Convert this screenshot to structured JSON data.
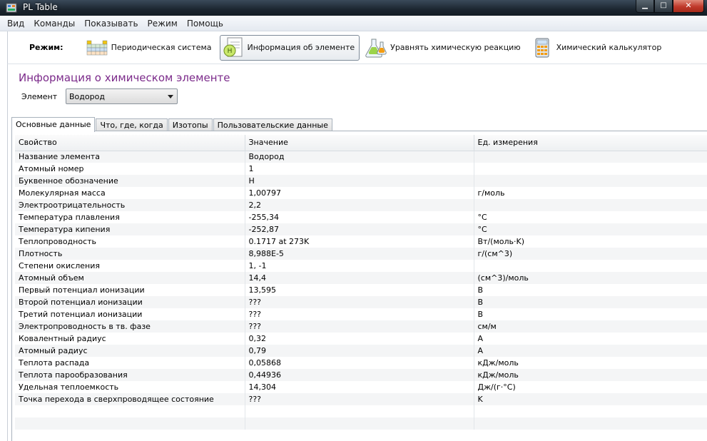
{
  "window": {
    "title": "PL Table"
  },
  "menu": [
    "Вид",
    "Команды",
    "Показывать",
    "Режим",
    "Помощь"
  ],
  "toolbar": {
    "mode_label": "Режим:",
    "buttons": [
      {
        "label": "Периодическая система",
        "icon": "periodic-table-icon",
        "active": false
      },
      {
        "label": "Информация об элементе",
        "icon": "element-info-icon",
        "active": true
      },
      {
        "label": "Уравнять химическую реакцию",
        "icon": "flask-icon",
        "active": false
      },
      {
        "label": "Химический калькулятор",
        "icon": "calculator-icon",
        "active": false
      }
    ]
  },
  "page": {
    "title": "Информация о химическом элементе",
    "element_label": "Элемент",
    "element_value": "Водород"
  },
  "tabs": [
    "Основные данные",
    "Что, где, когда",
    "Изотопы",
    "Пользовательские данные"
  ],
  "table": {
    "headers": [
      "Свойство",
      "Значение",
      "Ед. измерения"
    ],
    "rows": [
      [
        "Название элемента",
        "Водород",
        ""
      ],
      [
        "Атомный номер",
        "1",
        ""
      ],
      [
        "Буквенное обозначение",
        "H",
        ""
      ],
      [
        "Молекулярная масса",
        "1,00797",
        "г/моль"
      ],
      [
        "Электроотрицательность",
        "2,2",
        ""
      ],
      [
        "Температура плавления",
        "-255,34",
        "°C"
      ],
      [
        "Температура кипения",
        "-252,87",
        "°C"
      ],
      [
        "Теплопроводность",
        "0.1717 at 273K",
        "Вт/(моль·K)"
      ],
      [
        "Плотность",
        "8,988E-5",
        "г/(см^3)"
      ],
      [
        "Степени окисления",
        "1, -1",
        ""
      ],
      [
        "Атомный объем",
        "14,4",
        "(см^3)/моль"
      ],
      [
        "Первый потенциал ионизации",
        "13,595",
        "В"
      ],
      [
        "Второй потенциал ионизации",
        "???",
        "В"
      ],
      [
        "Третий потенциал ионизации",
        "???",
        "В"
      ],
      [
        "Электропроводность в тв. фазе",
        "???",
        "см/м"
      ],
      [
        "Ковалентный радиус",
        "0,32",
        "A"
      ],
      [
        "Атомный радиус",
        "0,79",
        "A"
      ],
      [
        "Теплота распада",
        "0,05868",
        "кДж/моль"
      ],
      [
        "Теплота парообразования",
        "0,44936",
        "кДж/моль"
      ],
      [
        "Удельная теплоемкость",
        "14,304",
        "Дж/(г·°C)"
      ],
      [
        "Точка перехода в сверхпроводящее состояние",
        "???",
        "K"
      ]
    ]
  },
  "colors": {
    "title_accent": "#7b2a8a",
    "close_button": "#c0392b"
  }
}
